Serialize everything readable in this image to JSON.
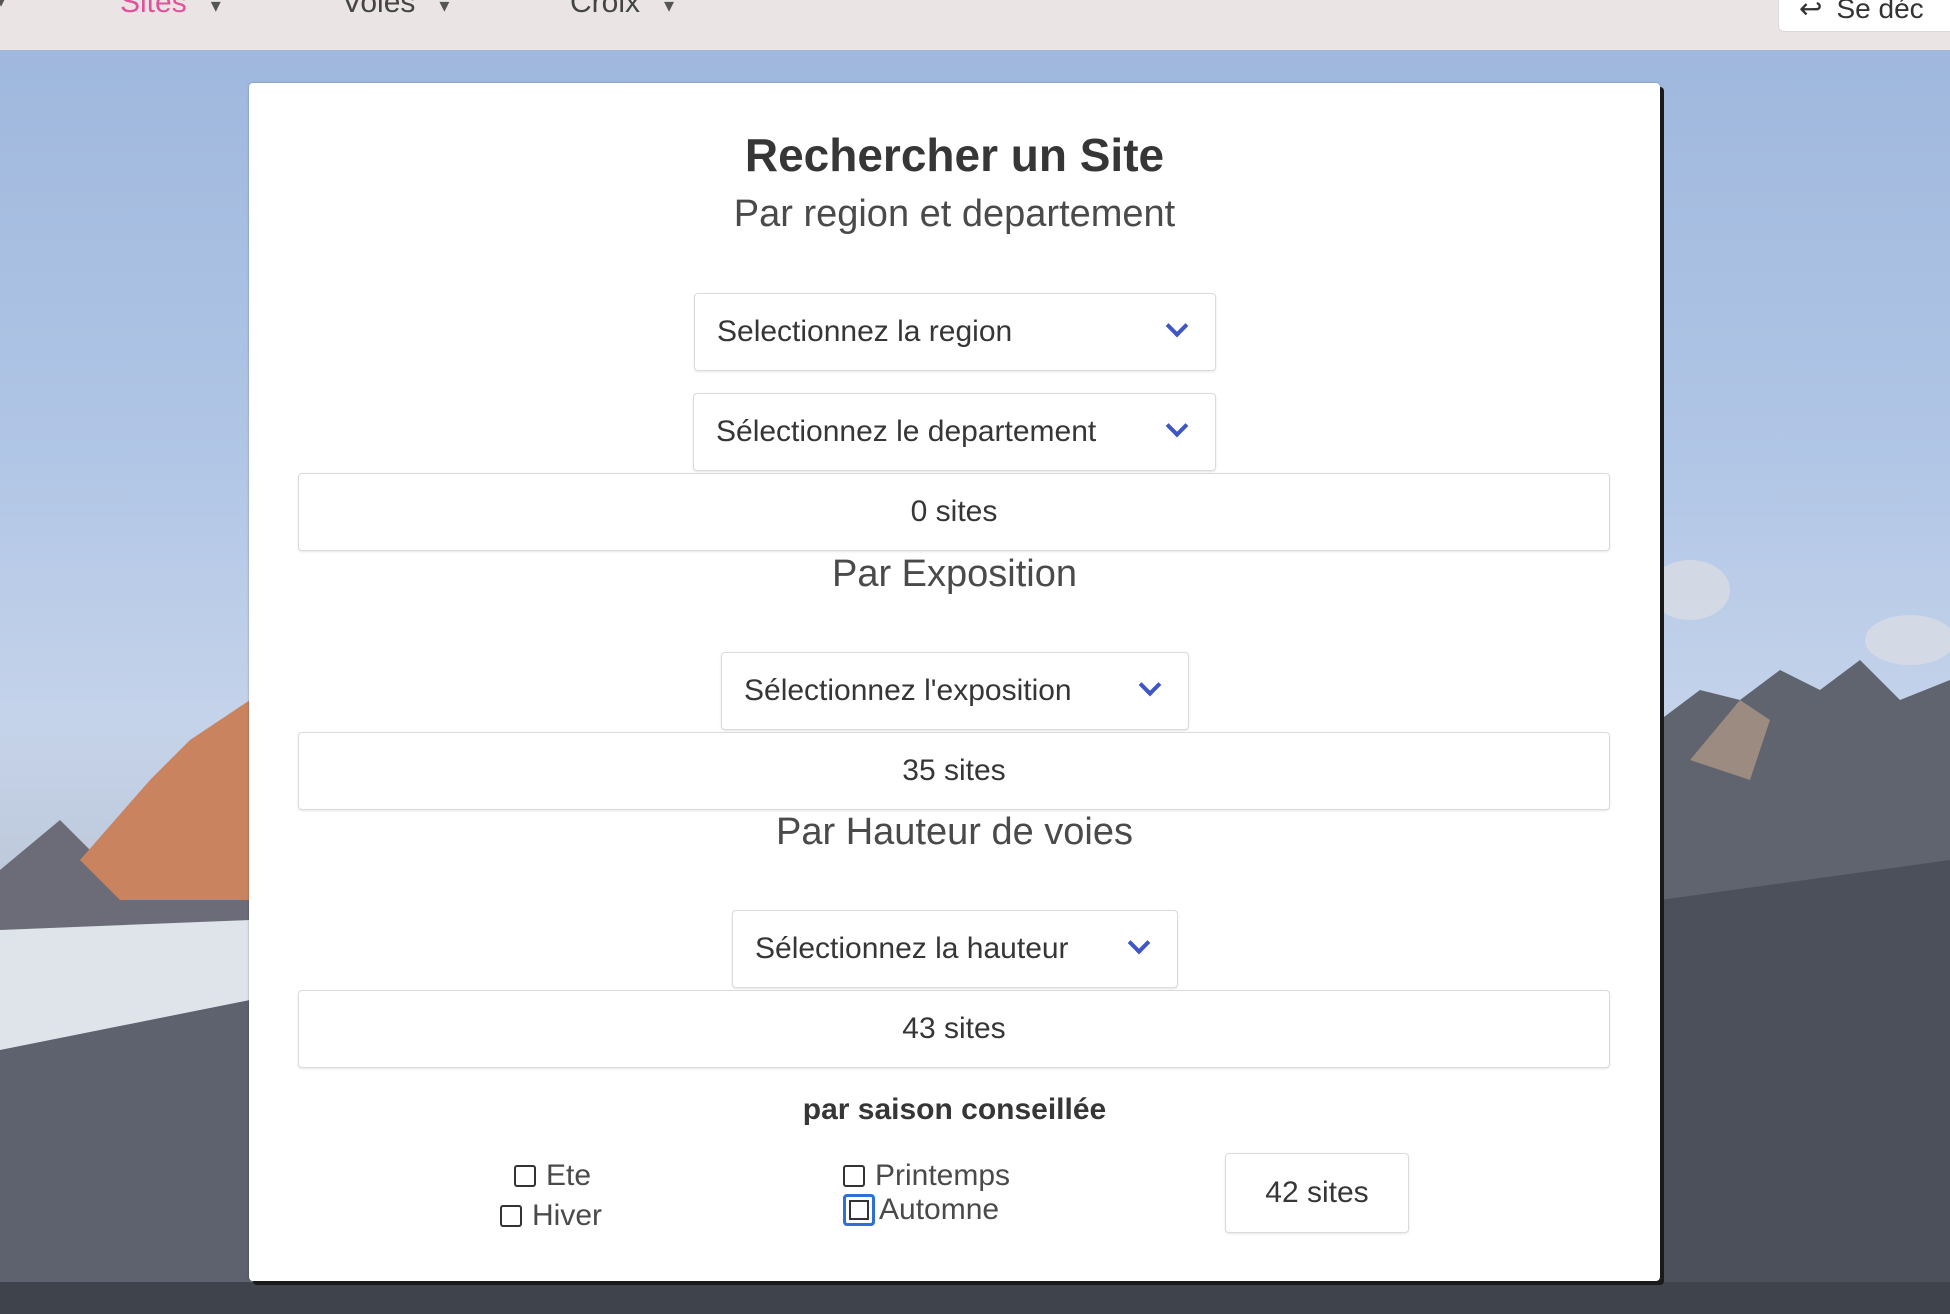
{
  "navbar": {
    "items": [
      {
        "label": "Sites",
        "active": true
      },
      {
        "label": "Voies",
        "active": false
      },
      {
        "label": "Croix",
        "active": false
      }
    ],
    "account_label": "Se déc",
    "active_color": "#e0529c"
  },
  "search": {
    "title": "Rechercher un Site",
    "region_section": {
      "subtitle": "Par region et departement",
      "region_select": "Selectionnez la region",
      "departement_select": "Sélectionnez le departement",
      "count": "0 sites"
    },
    "exposition_section": {
      "subtitle": "Par Exposition",
      "select": "Sélectionnez l'exposition",
      "count": "35 sites"
    },
    "hauteur_section": {
      "subtitle": "Par Hauteur de voies",
      "select": "Sélectionnez la hauteur",
      "count": "43 sites"
    },
    "saison_section": {
      "label": "par saison conseillée",
      "options": [
        {
          "label": "Ete",
          "checked": false
        },
        {
          "label": "Hiver",
          "checked": false
        },
        {
          "label": "Printemps",
          "checked": false
        },
        {
          "label": "Automne",
          "checked": false,
          "focused": true
        }
      ],
      "count": "42 sites"
    }
  },
  "colors": {
    "select_arrow": "#3e56c8",
    "focus_ring": "#2f6fd6"
  }
}
